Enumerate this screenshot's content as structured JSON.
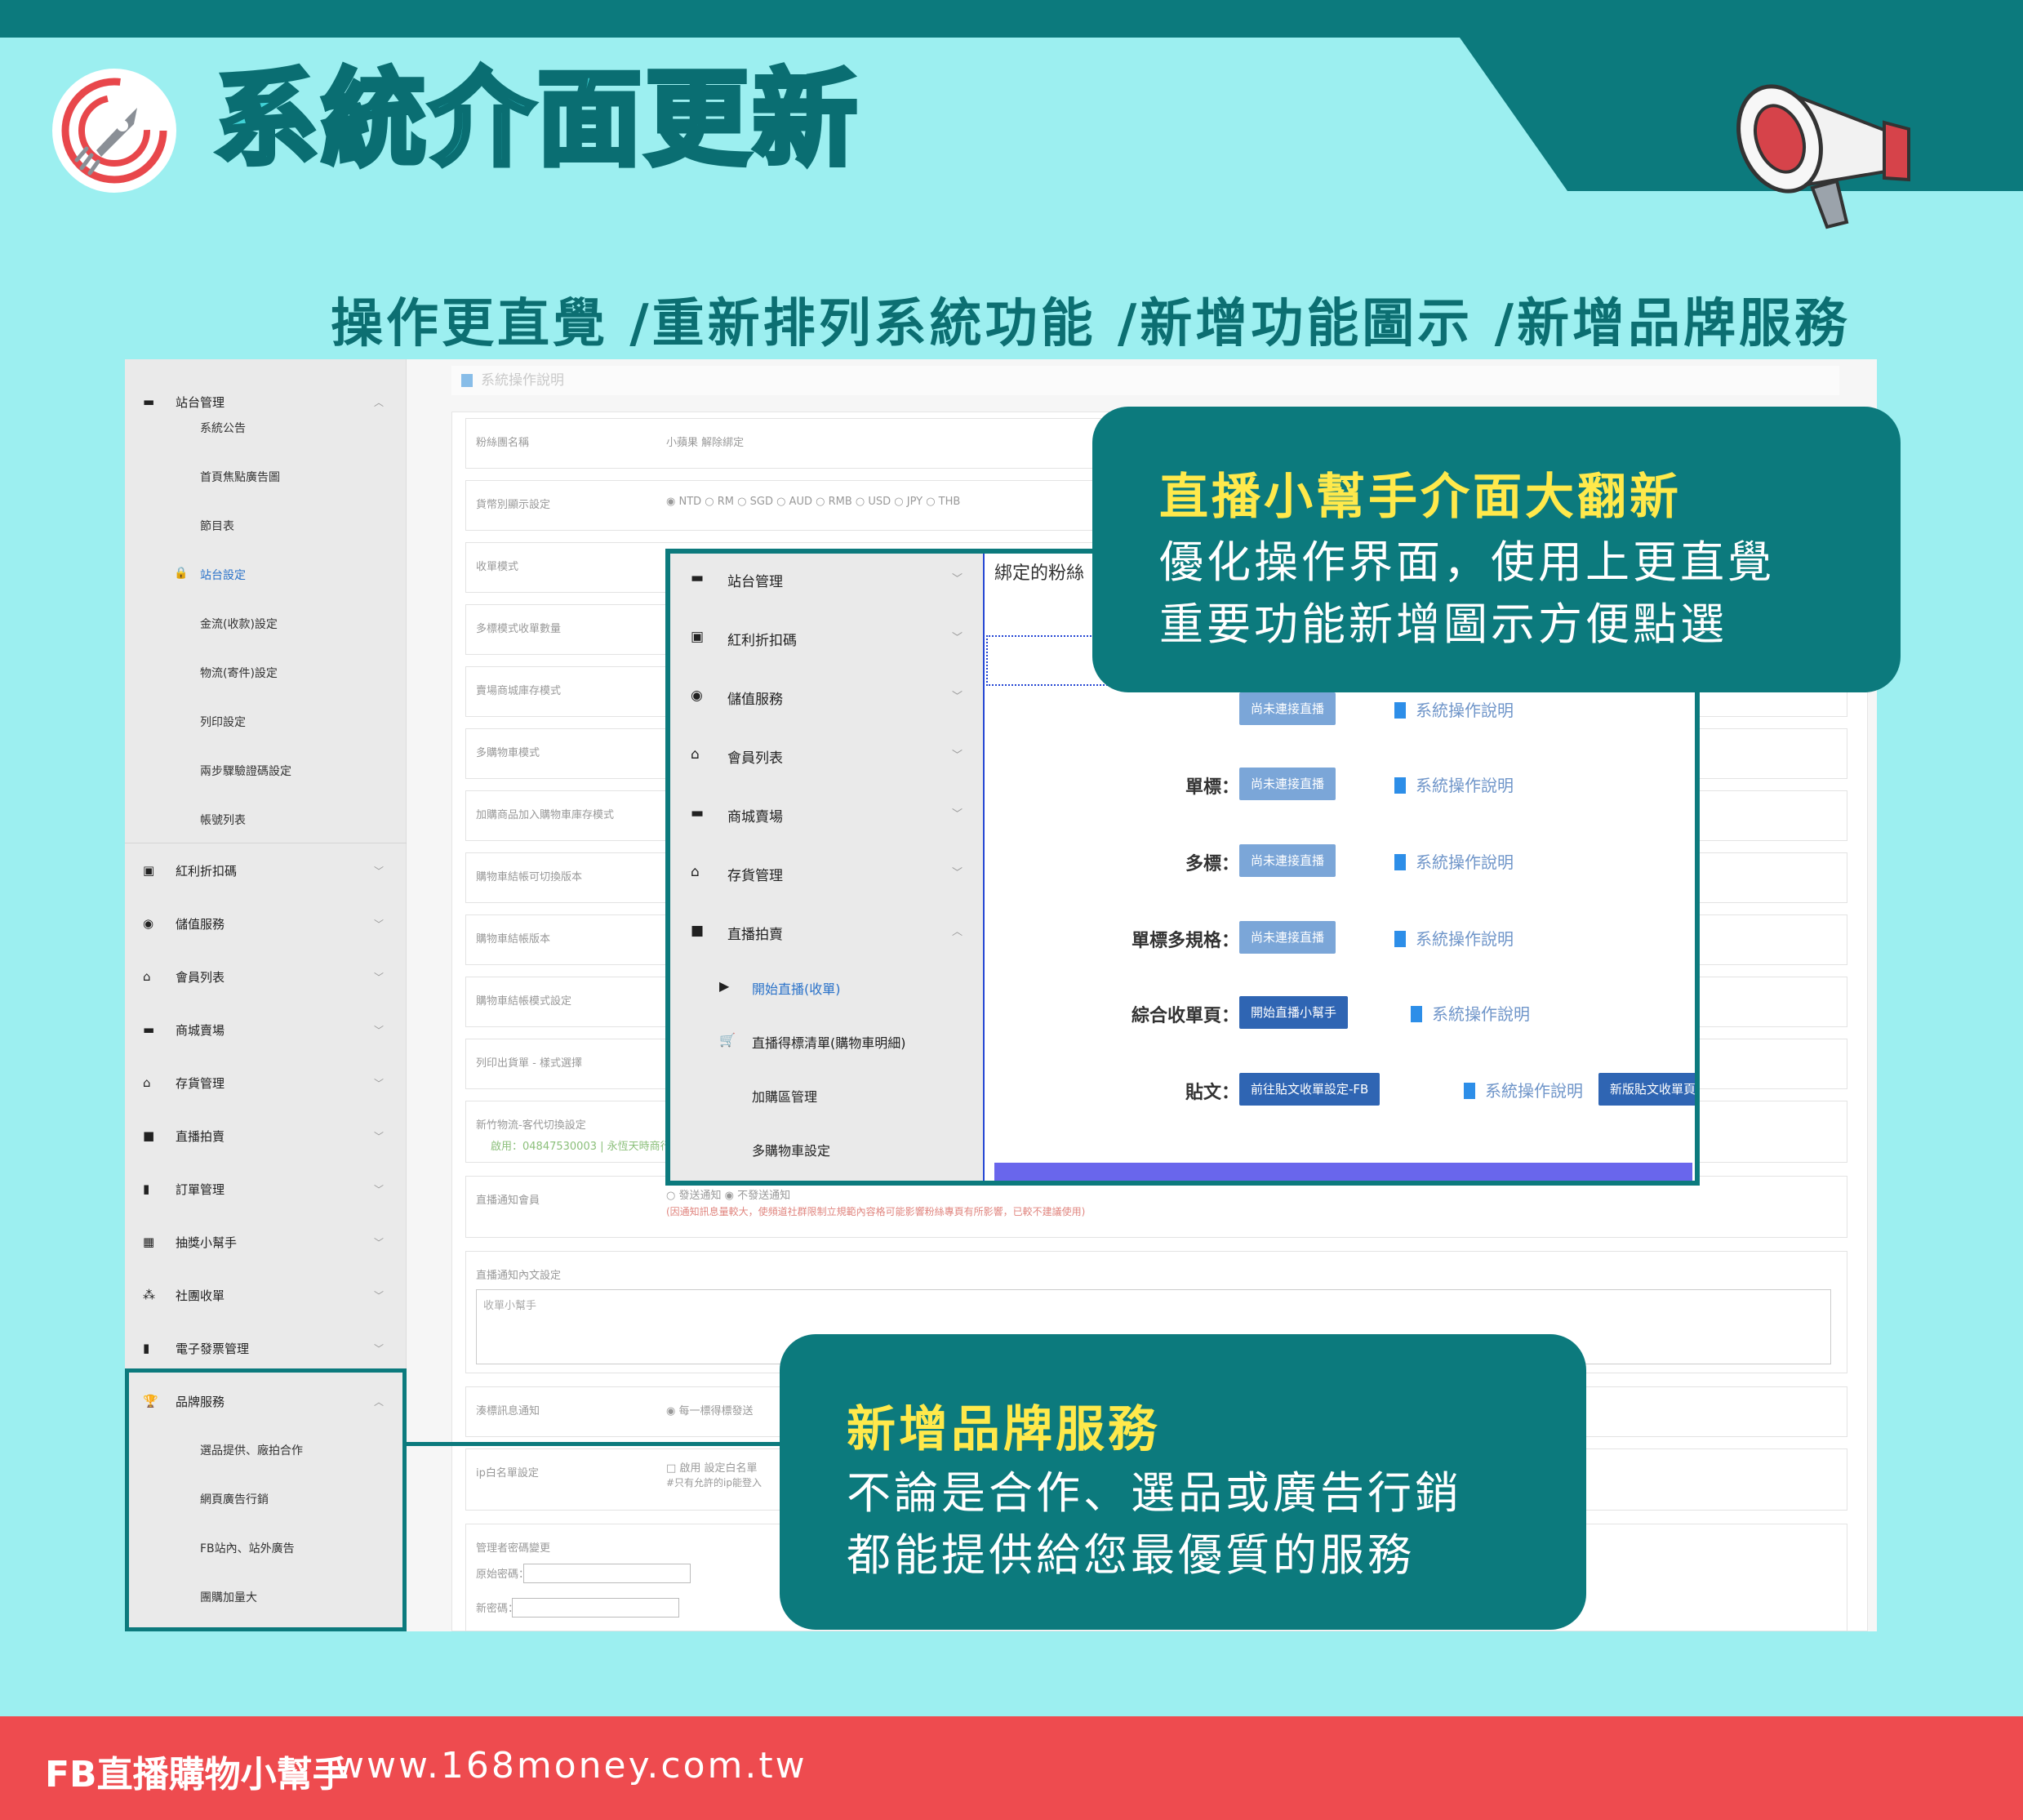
{
  "header": {
    "title": "系統介面更新",
    "subtitle": "操作更直覺 /重新排列系統功能 /新增功能圖示 /新增品牌服務"
  },
  "sidebar": {
    "top": {
      "label": "站台管理",
      "icon": "store-icon"
    },
    "subs": [
      "系統公告",
      "首頁焦點廣告圖",
      "節目表",
      "站台設定",
      "金流(收款)設定",
      "物流(寄件)設定",
      "列印設定",
      "兩步驟驗證碼設定",
      "帳號列表"
    ],
    "items": [
      {
        "label": "紅利折扣碼",
        "icon": "ticket-icon"
      },
      {
        "label": "儲值服務",
        "icon": "wallet-icon"
      },
      {
        "label": "會員列表",
        "icon": "home-user-icon"
      },
      {
        "label": "商城賣場",
        "icon": "store-icon"
      },
      {
        "label": "存貨管理",
        "icon": "warehouse-icon"
      },
      {
        "label": "直播拍賣",
        "icon": "video-icon"
      },
      {
        "label": "訂單管理",
        "icon": "clipboard-icon"
      },
      {
        "label": "抽獎小幫手",
        "icon": "gift-icon"
      },
      {
        "label": "社團收單",
        "icon": "group-icon"
      },
      {
        "label": "電子發票管理",
        "icon": "invoice-icon"
      }
    ],
    "brand": {
      "label": "品牌服務",
      "icon": "trophy-icon",
      "subs": [
        "選品提供、廠拍合作",
        "網頁廣告行銷",
        "FB站內、站外廣告",
        "團購加量大"
      ]
    }
  },
  "content": {
    "head": "系統操作說明",
    "rows": [
      {
        "label": "粉絲團名稱",
        "value": "小蘋果 解除綁定"
      },
      {
        "label": "貨幣別顯示設定",
        "value": "◉ NTD ○ RM ○ SGD ○ AUD ○ RMB ○ USD ○ JPY ○ THB"
      },
      {
        "label": "收單模式",
        "value": ""
      },
      {
        "label": "多標模式收單數量",
        "value": ""
      },
      {
        "label": "賣場商城庫存模式",
        "value": ""
      },
      {
        "label": "多購物車模式",
        "value": ""
      },
      {
        "label": "加購商品加入購物車庫存模式",
        "value": ""
      },
      {
        "label": "購物車結帳可切換版本",
        "value": ""
      },
      {
        "label": "購物車結帳版本",
        "value": ""
      },
      {
        "label": "購物車結帳模式設定",
        "value": ""
      },
      {
        "label": "列印出貨單 - 樣式選擇",
        "value": ""
      },
      {
        "label": "新竹物流-客代切換設定",
        "value": "啟用：04847530003 | 永恆天時商行"
      },
      {
        "label": "直播通知會員",
        "value": "○ 發送通知 ◉ 不發送通知"
      },
      {
        "label": "直播通知內文設定",
        "value": ""
      },
      {
        "label": "湊標訊息通知",
        "value": "◉ 每一標得標發送"
      },
      {
        "label": "ip白名單設定",
        "value": "□ 啟用 設定白名單"
      },
      {
        "label": "管理者密碼變更",
        "value": ""
      }
    ],
    "notify_note": "(因通知訊息量較大，使頻道社群限制立規範內容格可能影響粉絲專頁有所影響，已較不建議使用)",
    "textarea_placeholder": "收單小幫手",
    "ip_note": "#只有允許的ip能登入",
    "pw_old": "原始密碼：",
    "pw_new": "新密碼："
  },
  "zoom": {
    "menu": [
      {
        "label": "站台管理",
        "icon": "store-icon"
      },
      {
        "label": "紅利折扣碼",
        "icon": "ticket-icon"
      },
      {
        "label": "儲值服務",
        "icon": "wallet-icon"
      },
      {
        "label": "會員列表",
        "icon": "home-user-icon"
      },
      {
        "label": "商城賣場",
        "icon": "store-icon"
      },
      {
        "label": "存貨管理",
        "icon": "warehouse-icon"
      },
      {
        "label": "直播拍賣",
        "icon": "video-icon"
      }
    ],
    "live_subs": [
      {
        "label": "開始直播(收單)",
        "icon": "play-circle-icon"
      },
      {
        "label": "直播得標清單(購物車明細)",
        "icon": "cart-icon"
      },
      {
        "label": "加購區管理",
        "icon": ""
      },
      {
        "label": "多購物車設定",
        "icon": ""
      }
    ],
    "bound_text": "綁定的粉絲",
    "rows": [
      {
        "label": "",
        "button": "尚未連接直播",
        "link": "系統操作說明"
      },
      {
        "label": "單標：",
        "button": "尚未連接直播",
        "link": "系統操作說明"
      },
      {
        "label": "多標：",
        "button": "尚未連接直播",
        "link": "系統操作說明"
      },
      {
        "label": "單標多規格：",
        "button": "尚未連接直播",
        "link": "系統操作說明"
      },
      {
        "label": "綜合收單頁：",
        "button": "開始直播小幫手",
        "link": "系統操作說明"
      },
      {
        "label": "貼文：",
        "button": "前往貼文收單設定-FB",
        "link": "系統操作說明",
        "button2": "新版貼文收單頁"
      }
    ]
  },
  "callout1": {
    "title": "直播小幫手介面大翻新",
    "lines": [
      "優化操作界面，使用上更直覺",
      "重要功能新增圖示方便點選"
    ]
  },
  "callout2": {
    "title": "新增品牌服務",
    "lines": [
      "不論是合作、選品或廣告行銷",
      "都能提供給您最優質的服務"
    ]
  },
  "footer": {
    "brand": "FB直播購物小幫手",
    "url": "www.168money.com.tw"
  },
  "colors": {
    "teal": "#0c7a7d",
    "background": "#9ceff0",
    "accent_yellow": "#ffe94b",
    "footer_red": "#ee4b4f",
    "link_blue": "#2f65b3"
  }
}
